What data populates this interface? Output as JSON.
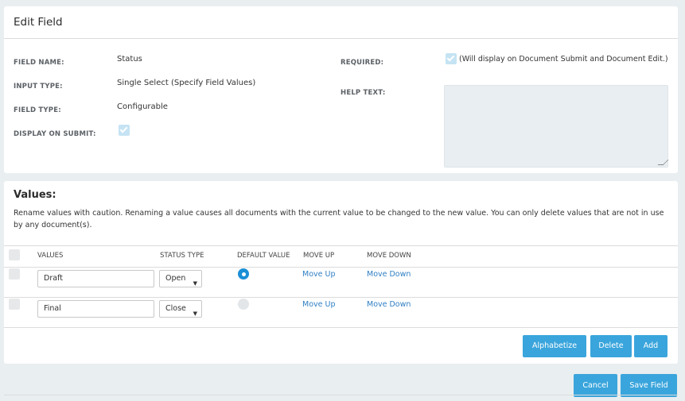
{
  "edit_field": {
    "title": "Edit Field",
    "field_name_label": "FIELD NAME:",
    "field_name_value": "Status",
    "input_type_label": "INPUT TYPE:",
    "input_type_value": "Single Select (Specify Field Values)",
    "field_type_label": "FIELD TYPE:",
    "field_type_value": "Configurable",
    "display_on_submit_label": "DISPLAY ON SUBMIT:",
    "display_on_submit_checked": true,
    "required_label": "REQUIRED:",
    "required_checked": true,
    "required_note": "(Will display on Document Submit and Document Edit.)",
    "help_text_label": "HELP TEXT:",
    "help_text_value": ""
  },
  "values": {
    "title": "Values:",
    "description": "Rename values with caution. Renaming a value causes all documents with the current value to be changed to the new value. You can only delete values that are not in use by any document(s).",
    "columns": [
      "VALUES",
      "STATUS TYPE",
      "DEFAULT VALUE",
      "MOVE UP",
      "MOVE DOWN"
    ],
    "rows": [
      {
        "value": "Draft",
        "status_type": "Open",
        "default": true,
        "move_up": "Move Up",
        "move_down": "Move Down"
      },
      {
        "value": "Final",
        "status_type": "Close",
        "default": false,
        "move_up": "Move Up",
        "move_down": "Move Down"
      }
    ],
    "buttons": {
      "alphabetize": "Alphabetize",
      "delete": "Delete",
      "add": "Add"
    }
  },
  "footer": {
    "cancel": "Cancel",
    "save": "Save Field"
  },
  "colors": {
    "accent": "#3aa5dc",
    "link": "#2f7fc4",
    "radio_selected": "#1c8fd6",
    "checkbox_checked": "#c5e3f3"
  },
  "icons": {
    "checkbox": "checkmark-icon",
    "select": "caret-down-icon"
  }
}
